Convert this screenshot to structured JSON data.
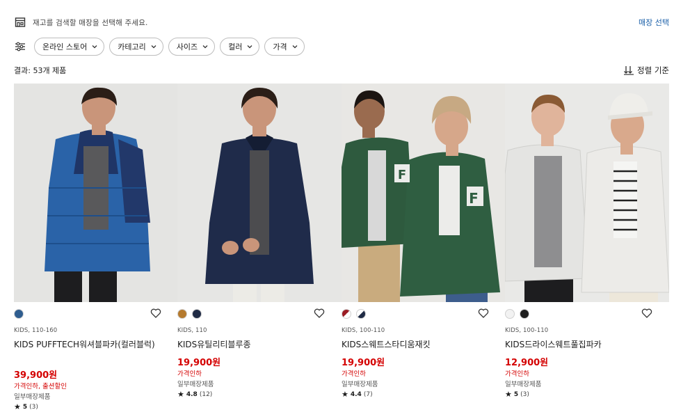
{
  "store": {
    "prompt": "재고를 검색할 매장을 선택해 주세요.",
    "select_label": "매장 선택",
    "icon": "store-icon"
  },
  "filters": [
    {
      "label": "온라인 스토어"
    },
    {
      "label": "카테고리"
    },
    {
      "label": "사이즈"
    },
    {
      "label": "컬러"
    },
    {
      "label": "가격"
    }
  ],
  "results": {
    "count_text": "결과: 53개 제품",
    "sort_label": "정렬 기준"
  },
  "colors": {
    "price_red": "#d40000",
    "link_blue": "#1a5fa8"
  },
  "products": [
    {
      "swatches": [
        "#2f5d8f"
      ],
      "meta": "KIDS, 110-160",
      "name": "KIDS PUFFTECH워셔블파카(컬러블럭)",
      "price": "39,900원",
      "flag": "가격인하, 출션할인",
      "availability": "일부매장제품",
      "rating": "5",
      "reviews": "(3)"
    },
    {
      "swatches": [
        "#b57a2e",
        "#1f2b45"
      ],
      "meta": "KIDS, 110",
      "name": "KIDS유틸리티블루종",
      "price": "19,900원",
      "flag": "가격인하",
      "availability": "일부매장제품",
      "rating": "4.8",
      "reviews": "(12)"
    },
    {
      "swatches": [
        "#9b1c24",
        "#1f2b45"
      ],
      "meta": "KIDS, 100-110",
      "name": "KIDS스웨트스타디움재킷",
      "price": "19,900원",
      "flag": "가격인하",
      "availability": "일부매장제품",
      "rating": "4.4",
      "reviews": "(7)"
    },
    {
      "swatches": [
        "#f2f2f2",
        "#1e1e1e"
      ],
      "meta": "KIDS, 100-110",
      "name": "KIDS드라이스웨트풀집파카",
      "price": "12,900원",
      "flag": "가격인하",
      "availability": "일부매장제품",
      "rating": "5",
      "reviews": "(3)"
    }
  ]
}
